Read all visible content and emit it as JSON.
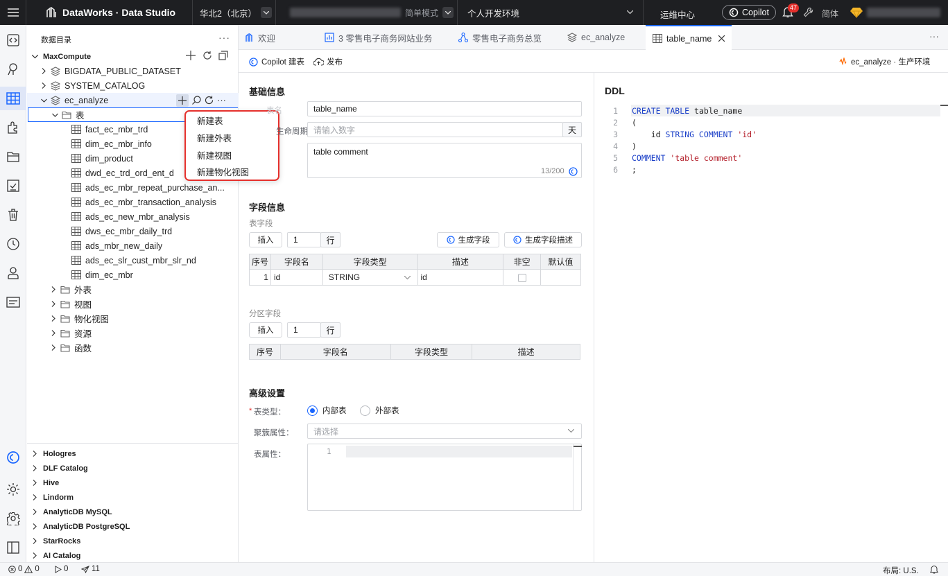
{
  "topbar": {
    "product": "DataWorks · Data Studio",
    "region": "华北2（北京）",
    "mode": "简单模式",
    "environment": "个人开发环境",
    "ops_center": "运维中心",
    "copilot": "Copilot",
    "notifications": "47",
    "language": "简体"
  },
  "sidebar": {
    "title": "数据目录",
    "maxcompute_label": "MaxCompute",
    "tree": [
      {
        "label": "BIGDATA_PUBLIC_DATASET"
      },
      {
        "label": "SYSTEM_CATALOG"
      },
      {
        "label": "ec_analyze"
      },
      {
        "label": "表"
      },
      {
        "label": "fact_ec_mbr_trd"
      },
      {
        "label": "dim_ec_mbr_info"
      },
      {
        "label": "dim_product"
      },
      {
        "label": "dwd_ec_trd_ord_ent_d"
      },
      {
        "label": "ads_ec_mbr_repeat_purchase_an..."
      },
      {
        "label": "ads_ec_mbr_transaction_analysis"
      },
      {
        "label": "ads_ec_new_mbr_analysis"
      },
      {
        "label": "dws_ec_mbr_daily_trd"
      },
      {
        "label": "ads_mbr_new_daily"
      },
      {
        "label": "ads_ec_slr_cust_mbr_slr_nd"
      },
      {
        "label": "dim_ec_mbr"
      },
      {
        "label": "外表"
      },
      {
        "label": "视图"
      },
      {
        "label": "物化视图"
      },
      {
        "label": "资源"
      },
      {
        "label": "函数"
      }
    ],
    "sections": [
      "Hologres",
      "DLF Catalog",
      "Hive",
      "Lindorm",
      "AnalyticDB MySQL",
      "AnalyticDB PostgreSQL",
      "StarRocks",
      "AI Catalog"
    ]
  },
  "context_menu": {
    "items": [
      "新建表",
      "新建外表",
      "新建视图",
      "新建物化视图"
    ]
  },
  "tabs": [
    {
      "label": "欢迎"
    },
    {
      "label": "3 零售电子商务网站业务"
    },
    {
      "label": "零售电子商务总览"
    },
    {
      "label": "ec_analyze"
    },
    {
      "label": "table_name"
    }
  ],
  "toolbar": {
    "copilot_build": "Copilot 建表",
    "publish": "发布",
    "env_info": "ec_analyze · 生产环境"
  },
  "basic_info": {
    "title": "基础信息",
    "label_name_partial": "表名",
    "label_lifecycle_partial": "生命周期",
    "name_value": "table_name",
    "lifecycle_placeholder": "请输入数字",
    "lifecycle_unit": "天",
    "comment_value": "table comment",
    "comment_count": "13/200"
  },
  "field_info": {
    "title": "字段信息",
    "table_fields_label": "表字段",
    "insert": "插入",
    "insert_count": "1",
    "row_unit": "行",
    "gen_fields": "生成字段",
    "gen_desc": "生成字段描述",
    "columns": [
      "序号",
      "字段名",
      "字段类型",
      "描述",
      "非空",
      "默认值"
    ],
    "rows": [
      {
        "no": "1",
        "name": "id",
        "type": "STRING",
        "desc": "id"
      }
    ]
  },
  "partition": {
    "label": "分区字段",
    "insert": "插入",
    "insert_count": "1",
    "row_unit": "行",
    "columns": [
      "序号",
      "字段名",
      "字段类型",
      "描述"
    ]
  },
  "advanced": {
    "title": "高级设置",
    "table_type_label": "表类型：",
    "internal": "内部表",
    "external": "外部表",
    "cluster_label": "聚簇属性：",
    "cluster_placeholder": "请选择",
    "props_label": "表属性：",
    "props_line": "1"
  },
  "ddl": {
    "title": "DDL",
    "lines": [
      "1",
      "2",
      "3",
      "4",
      "5",
      "6"
    ],
    "code": {
      "l1_kw": "CREATE TABLE",
      "l1_name": " table_name",
      "l2": "(",
      "l3_name": "    id ",
      "l3_kw": "STRING COMMENT",
      "l3_str": " 'id'",
      "l4": ")",
      "l5_kw": "COMMENT",
      "l5_str": " 'table comment'",
      "l6": ";"
    }
  },
  "statusbar": {
    "errors": "0",
    "warnings": "0",
    "run": "0",
    "sent": "11",
    "layout": "布局: U.S."
  },
  "colors": {
    "accent": "#1a66ff",
    "highlight": "#e5302c",
    "topbar": "#1e1f22"
  }
}
